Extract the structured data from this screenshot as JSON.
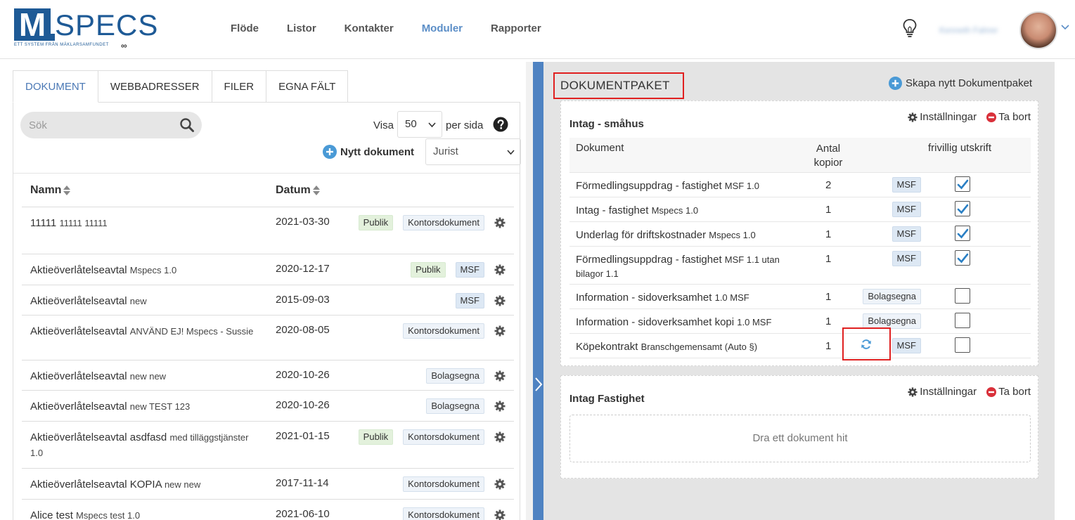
{
  "header": {
    "logo": {
      "letter": "M",
      "word": "SPECS",
      "tagline": "ETT SYSTEM FRÅN MÄKLARSAMFUNDET"
    },
    "nav": [
      "Flöde",
      "Listor",
      "Kontakter",
      "Moduler",
      "Rapporter"
    ],
    "active_nav": "Moduler",
    "username": "Kenneth Fahrer"
  },
  "left": {
    "tabs": [
      "DOKUMENT",
      "WEBBADRESSER",
      "FILER",
      "EGNA FÄLT"
    ],
    "active_tab": "DOKUMENT",
    "search_placeholder": "Sök",
    "visa_label": "Visa",
    "per_page": "50",
    "per_page_suffix": "per sida",
    "new_doc_label": "Nytt dokument",
    "role": "Jurist",
    "columns": {
      "name": "Namn",
      "date": "Datum"
    },
    "rows": [
      {
        "name": "11111",
        "sub": "11111   11111",
        "date": "2021-03-30",
        "badges": [
          "Publik",
          "Kontorsdokument"
        ]
      },
      {
        "name": "Aktieöverlåtelseavtal",
        "sub": "Mspecs   1.0",
        "date": "2020-12-17",
        "badges": [
          "Publik",
          "MSF"
        ]
      },
      {
        "name": "Aktieöverlåtelseavtal",
        "sub": "new",
        "date": "2015-09-03",
        "badges": [
          "MSF"
        ]
      },
      {
        "name": "Aktieöverlåtelseavtal",
        "sub": "ANVÄND EJ!   Mspecs - Sussie",
        "date": "2020-08-05",
        "badges": [
          "Kontorsdokument"
        ]
      },
      {
        "name": "Aktieöverlåtelseavtal",
        "sub": "new   new",
        "date": "2020-10-26",
        "badges": [
          "Bolagsegna"
        ]
      },
      {
        "name": "Aktieöverlåtelseavtal",
        "sub": "new   TEST 123",
        "date": "2020-10-26",
        "badges": [
          "Bolagsegna"
        ]
      },
      {
        "name": "Aktieöverlåtelseavtal asdfasd",
        "sub": "med tilläggstjänster   1.0",
        "date": "2021-01-15",
        "badges": [
          "Publik",
          "Kontorsdokument"
        ]
      },
      {
        "name": "Aktieöverlåtelseavtal KOPIA",
        "sub": "new   new",
        "date": "2017-11-14",
        "badges": [
          "Kontorsdokument"
        ]
      },
      {
        "name": "Alice test",
        "sub": "Mspecs test   1.0",
        "date": "2021-06-10",
        "badges": [
          "Kontorsdokument"
        ]
      }
    ]
  },
  "right": {
    "title": "DOKUMENTPAKET",
    "create_label": "Skapa nytt Dokumentpaket",
    "settings_label": "Inställningar",
    "delete_label": "Ta bort",
    "packages": [
      {
        "title": "Intag - småhus",
        "columns": {
          "doc": "Dokument",
          "count": "Antal kopior",
          "optional": "frivillig utskrift"
        },
        "items": [
          {
            "name": "Förmedlingsuppdrag - fastighet",
            "sub": "MSF 1.0",
            "count": "2",
            "badges": [
              "MSF"
            ],
            "checked": true
          },
          {
            "name": "Intag - fastighet",
            "sub": "Mspecs 1.0",
            "count": "1",
            "badges": [
              "MSF"
            ],
            "checked": true
          },
          {
            "name": "Underlag för driftskostnader",
            "sub": "Mspecs 1.0",
            "count": "1",
            "badges": [
              "MSF"
            ],
            "checked": true
          },
          {
            "name": "Förmedlingsuppdrag - fastighet",
            "sub": "MSF 1.1 utan bilagor 1.1",
            "count": "1",
            "badges": [
              "MSF"
            ],
            "checked": true
          },
          {
            "name": "Information - sidoverksamhet",
            "sub": "1.0 MSF",
            "count": "1",
            "badges": [
              "Bolagsegna"
            ],
            "checked": false
          },
          {
            "name": "Information - sidoverksamhet kopi",
            "sub": "1.0 MSF",
            "count": "1",
            "badges": [
              "Bolagsegna"
            ],
            "checked": false
          },
          {
            "name": "Köpekontrakt",
            "sub": "Branschgemensamt (Auto §)",
            "count": "1",
            "badges": [
              "MSF"
            ],
            "checked": false,
            "sync": true
          }
        ]
      },
      {
        "title": "Intag Fastighet",
        "dropzone": "Dra ett dokument hit"
      }
    ]
  },
  "colors": {
    "brand": "#1e5a96",
    "accent": "#5b8ec7",
    "highlight": "#e02020",
    "sidebar": "#4f83c2"
  }
}
